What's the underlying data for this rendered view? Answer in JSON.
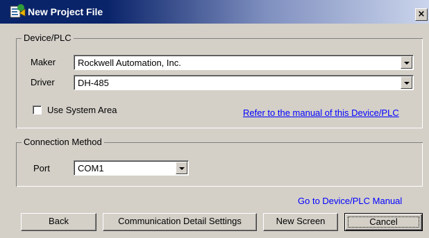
{
  "window": {
    "title": "New Project File",
    "close_glyph": "×",
    "icon": "project-file-icon"
  },
  "device_group": {
    "label": "Device/PLC",
    "maker_label": "Maker",
    "maker_value": "Rockwell Automation, Inc.",
    "driver_label": "Driver",
    "driver_value": "DH-485",
    "use_system_area_label": "Use System Area",
    "use_system_area_checked": false,
    "manual_link": "Refer to the manual of this Device/PLC"
  },
  "connection_group": {
    "label": "Connection Method",
    "port_label": "Port",
    "port_value": "COM1"
  },
  "footer": {
    "manual_link": "Go to Device/PLC Manual",
    "back_label": "Back",
    "comm_settings_label": "Communication Detail Settings",
    "new_screen_label": "New Screen",
    "cancel_label": "Cancel"
  },
  "colors": {
    "title_bar": "#0a246a",
    "dialog_face": "#d4d0c8",
    "link": "#0000ff"
  }
}
